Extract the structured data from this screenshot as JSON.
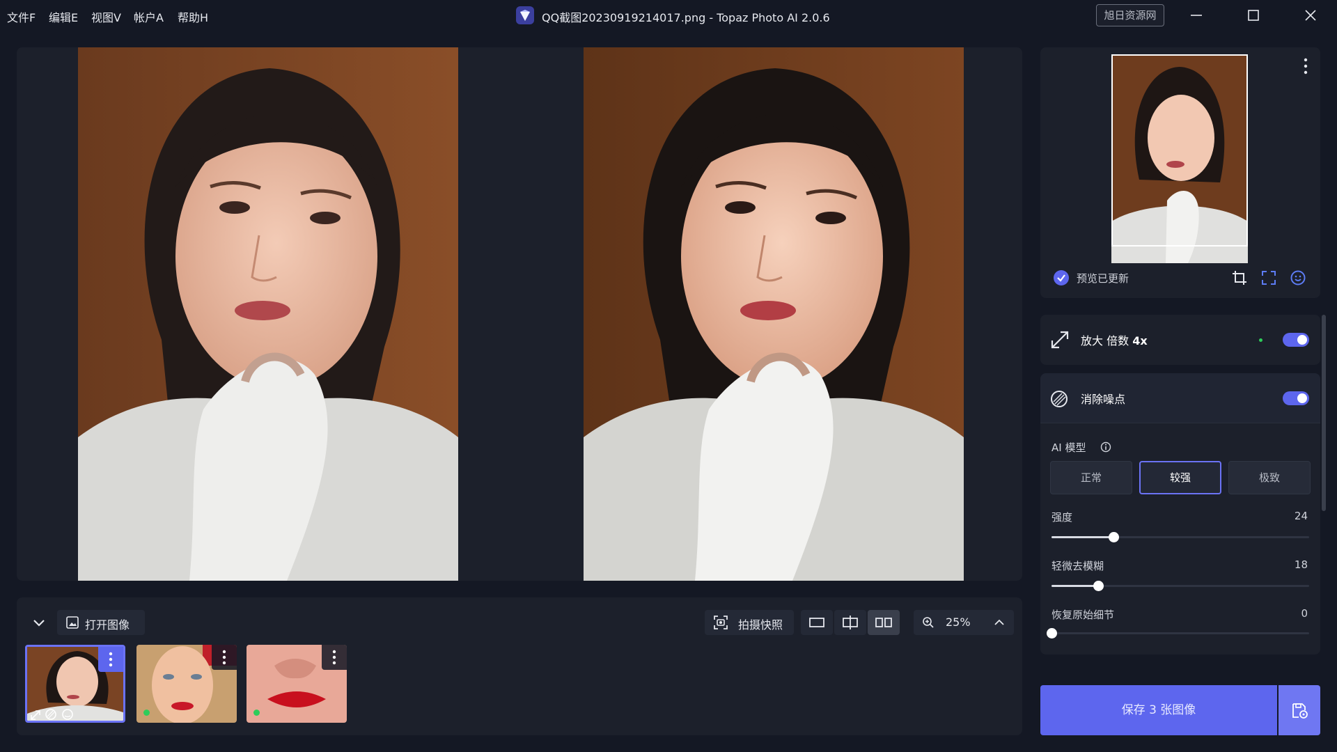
{
  "menu": [
    "文件F",
    "编辑E",
    "视图V",
    "帐户A",
    "帮助H"
  ],
  "window": {
    "title": "QQ截图20230919214017.png - Topaz Photo AI 2.0.6",
    "resource_button": "旭日资源网"
  },
  "toolbar": {
    "open_image": "打开图像",
    "snapshot": "拍摄快照",
    "zoom": "25%"
  },
  "navigator": {
    "status": "预览已更新"
  },
  "upscale": {
    "title": "放大 倍数",
    "factor": "4x",
    "enabled": true
  },
  "denoise": {
    "title": "消除噪点",
    "enabled": true,
    "model_label": "AI 模型",
    "models": [
      "正常",
      "较强",
      "极致"
    ],
    "selected_model": "较强",
    "sliders": [
      {
        "label": "强度",
        "value": "24",
        "level": 24
      },
      {
        "label": "轻微去模糊",
        "value": "18",
        "level": 18
      },
      {
        "label": "恢复原始细节",
        "value": "0",
        "level": 0
      }
    ]
  },
  "save": {
    "label": "保存 3 张图像"
  },
  "colors": {
    "accent": "#5d66ee",
    "background": "#141824",
    "panel": "#1c202b"
  }
}
